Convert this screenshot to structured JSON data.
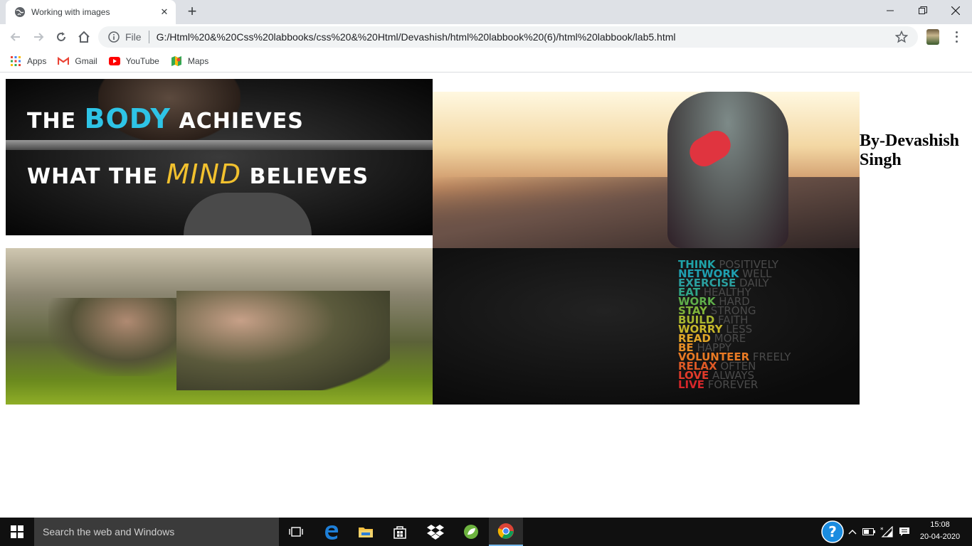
{
  "browser": {
    "tab_title": "Working with images",
    "omnibox": {
      "scheme_label": "File",
      "url": "G:/Html%20&%20Css%20labbooks/css%20&%20Html/Devashish/html%20labbook%20(6)/html%20labbook/lab5.html"
    },
    "bookmarks": [
      {
        "label": "Apps",
        "icon": "apps-grid-icon"
      },
      {
        "label": "Gmail",
        "icon": "gmail-icon"
      },
      {
        "label": "YouTube",
        "icon": "youtube-icon"
      },
      {
        "label": "Maps",
        "icon": "maps-icon"
      }
    ]
  },
  "page": {
    "images": [
      {
        "name": "body-mind-image",
        "text_line1": [
          "THE ",
          "BODY",
          " ACHIEVES"
        ],
        "text_line2": [
          "WHAT THE ",
          "MIND",
          " BELIEVES"
        ]
      },
      {
        "name": "runner-image"
      },
      {
        "name": "military-pushup-image"
      },
      {
        "name": "think-positively-image",
        "rows": [
          {
            "w1": "THINK",
            "w2": "POSITIVELY",
            "color": "#1fa3a8"
          },
          {
            "w1": "NETWORK",
            "w2": "WELL",
            "color": "#1f9fb0"
          },
          {
            "w1": "EXERCISE",
            "w2": "DAILY",
            "color": "#2aa0a0"
          },
          {
            "w1": "EAT",
            "w2": "HEALTHY",
            "color": "#2fa68a"
          },
          {
            "w1": "WORK",
            "w2": "HARD",
            "color": "#5fae4a"
          },
          {
            "w1": "STAY",
            "w2": "STRONG",
            "color": "#7fb43a"
          },
          {
            "w1": "BUILD",
            "w2": "FAITH",
            "color": "#a9b830"
          },
          {
            "w1": "WORRY",
            "w2": "LESS",
            "color": "#c9b82a"
          },
          {
            "w1": "READ",
            "w2": "MORE",
            "color": "#e0a628"
          },
          {
            "w1": "BE",
            "w2": "HAPPY",
            "color": "#e88f25"
          },
          {
            "w1": "VOLUNTEER",
            "w2": "FREELY",
            "color": "#e87a24"
          },
          {
            "w1": "RELAX",
            "w2": "OFTEN",
            "color": "#e05a26"
          },
          {
            "w1": "LOVE",
            "w2": "ALWAYS",
            "color": "#e03a2a"
          },
          {
            "w1": "LIVE",
            "w2": "FOREVER",
            "color": "#d6262a"
          }
        ]
      }
    ],
    "author": "By-Devashish Singh"
  },
  "taskbar": {
    "search_placeholder": "Search the web and Windows",
    "time": "15:08",
    "date": "20-04-2020"
  }
}
